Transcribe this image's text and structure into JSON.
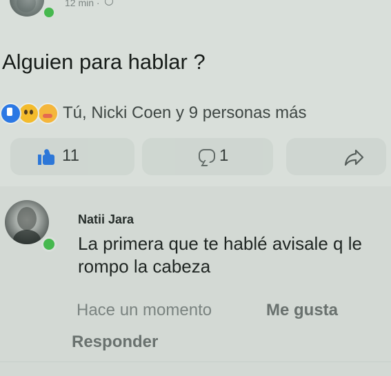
{
  "post": {
    "time": "12 min",
    "time_separator": "·",
    "text": "Alguien para hablar ?",
    "reactions": {
      "summary": "Tú, Nicki Coen y 9 personas más",
      "icons": [
        "like-icon",
        "wow-icon",
        "care-icon"
      ]
    },
    "actions": {
      "like_count": "11",
      "comment_count": "1"
    }
  },
  "comment": {
    "author": "Natii Jara",
    "text": "La primera que te hablé avisale q le rompo la cabeza",
    "time": "Hace un momento",
    "like_label": "Me gusta",
    "reply_label": "Responder"
  },
  "colors": {
    "background": "#d9dfda",
    "accent": "#2472d8",
    "online": "#46b84e"
  }
}
